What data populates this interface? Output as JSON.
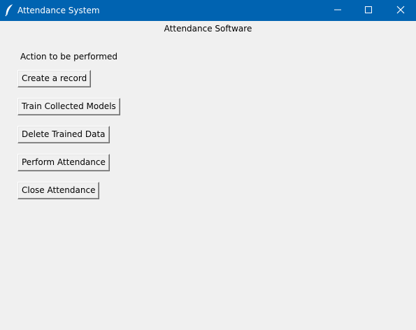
{
  "window": {
    "title": "Attendance System",
    "icon": "feather-icon",
    "controls": [
      "minimize-icon",
      "maximize-icon",
      "close-icon"
    ]
  },
  "main": {
    "heading": "Attendance Software",
    "action_label": "Action to be performed",
    "buttons": [
      {
        "label": "Create a record"
      },
      {
        "label": "Train Collected Models"
      },
      {
        "label": "Delete Trained Data"
      },
      {
        "label": "Perform Attendance"
      },
      {
        "label": "Close Attendance"
      }
    ]
  },
  "colors": {
    "titlebar": "#0063b1",
    "background": "#f0f0f0"
  }
}
